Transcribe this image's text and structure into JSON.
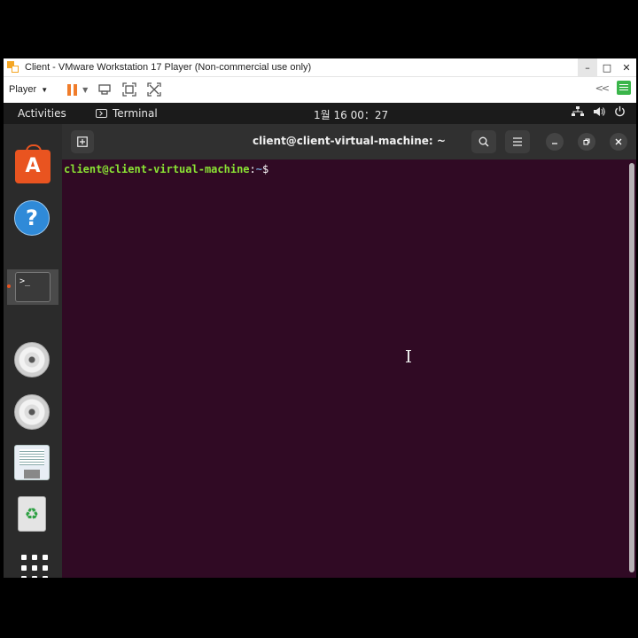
{
  "vmware": {
    "title": "Client - VMware Workstation 17 Player (Non-commercial use only)",
    "player_menu": "Player",
    "window_controls": {
      "minimize": "–",
      "maximize": "□",
      "close": "✕"
    },
    "toolbar_icons": [
      "pause-icon",
      "send-ctrl-alt-del-icon",
      "fullscreen-icon",
      "unity-icon",
      "back-icon",
      "notes-icon"
    ],
    "back_glyph": "<<"
  },
  "ubuntu": {
    "topbar": {
      "activities": "Activities",
      "app_name": "Terminal",
      "clock": "1월 16  00：27"
    },
    "dock": {
      "items": [
        "app-center-icon",
        "help-icon",
        "terminal-icon",
        "dvd-icon",
        "dvd-icon",
        "floppy-icon",
        "trash-icon",
        "show-apps-icon"
      ],
      "terminal_glyph": ">_",
      "trash_glyph": "♻"
    },
    "terminal": {
      "title": "client@client-virtual-machine: ~",
      "prompt_user": "client@client-virtual-machine",
      "prompt_colon": ":",
      "prompt_path": "~",
      "prompt_symbol": "$",
      "colors": {
        "background": "#300a24",
        "user": "#8ae234",
        "path": "#729fcf"
      }
    }
  }
}
